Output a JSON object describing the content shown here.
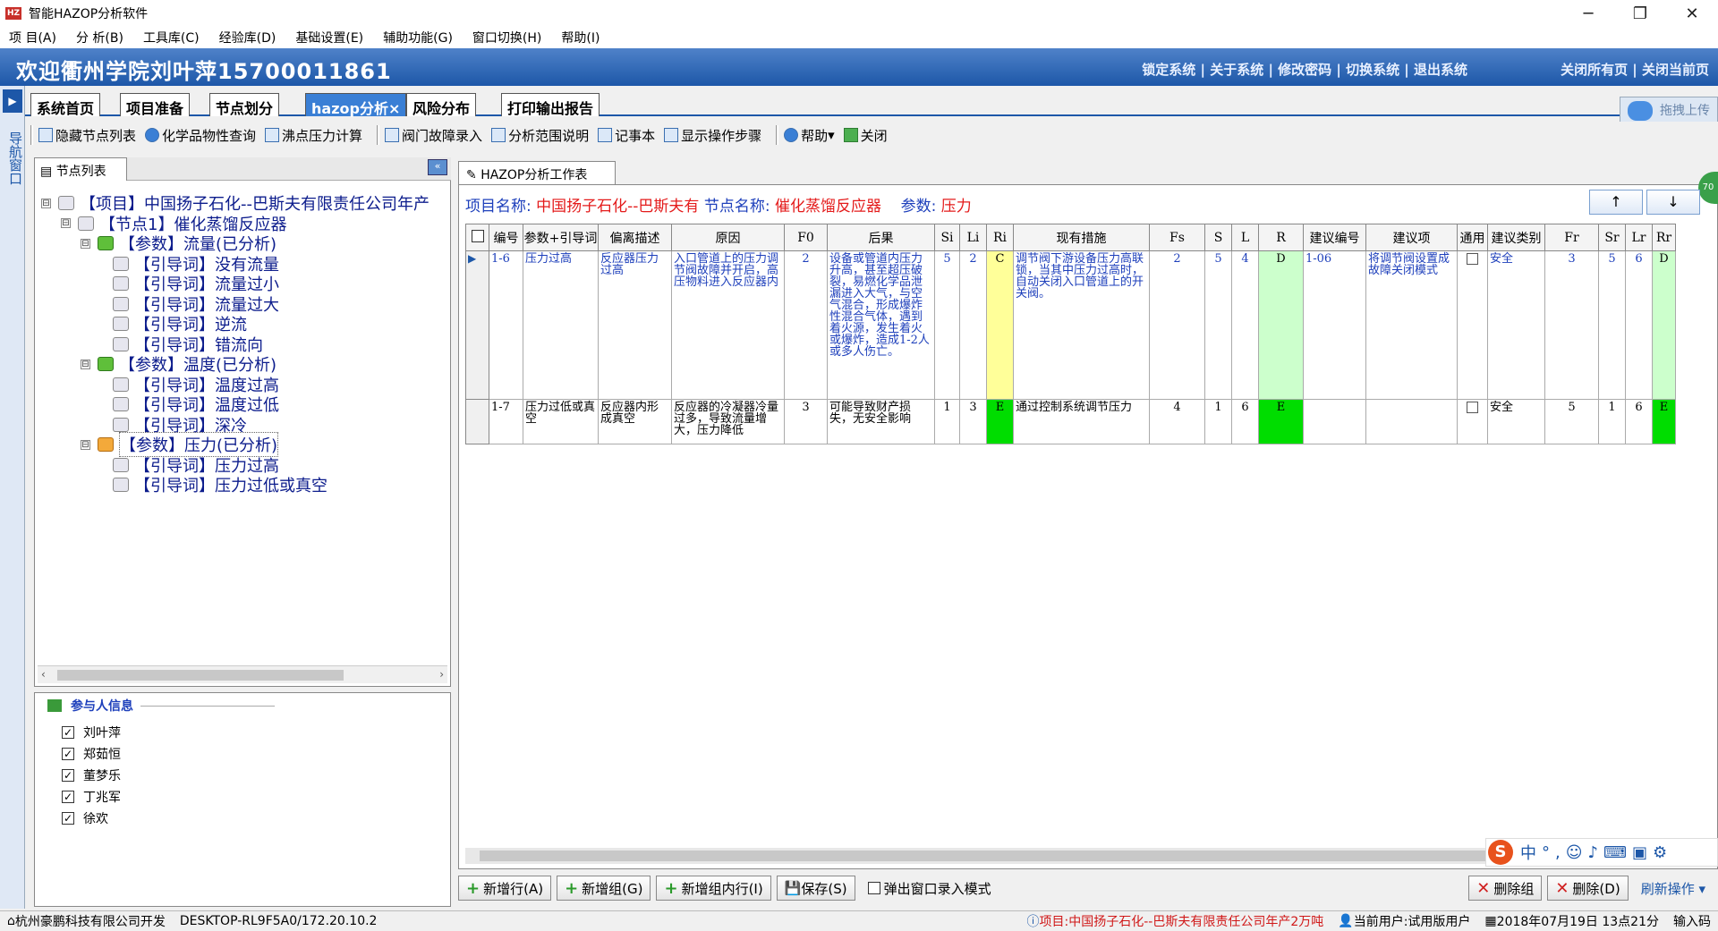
{
  "window": {
    "title": "智能HAZOP分析软件",
    "app_icon_text": "HZ"
  },
  "menu": [
    "项 目(A)",
    "分 析(B)",
    "工具库(C)",
    "经验库(D)",
    "基础设置(E)",
    "辅助功能(G)",
    "窗口切换(H)",
    "帮助(I)"
  ],
  "banner": {
    "welcome": "欢迎衢州学院刘叶萍15700011861",
    "links": "锁定系统 | 关于系统 | 修改密码 | 切换系统 | 退出系统",
    "links2": "关闭所有页 | 关闭当前页"
  },
  "navstrip": {
    "label": "导航窗口"
  },
  "tabs": [
    "系统首页",
    "项目准备",
    "节点划分",
    "hazop分析",
    "风险分布",
    "打印输出报告"
  ],
  "active_tab_close": "×",
  "drag_upload": "拖拽上传",
  "toolbar": [
    "隐藏节点列表",
    "化学品物性查询",
    "沸点压力计算",
    "阀门故障录入",
    "分析范围说明",
    "记事本",
    "显示操作步骤",
    "帮助",
    "关闭"
  ],
  "left_panel": {
    "tab": "节点列表",
    "collapse": "«"
  },
  "tree": [
    {
      "level": 0,
      "exp": "⊟",
      "text": "【项目】中国扬子石化--巴斯夫有限责任公司年产",
      "icon": "project"
    },
    {
      "level": 1,
      "exp": "⊟",
      "text": "【节点1】催化蒸馏反应器",
      "icon": "node"
    },
    {
      "level": 2,
      "exp": "⊟",
      "text": "【参数】流量(已分析)",
      "icon": "param-green"
    },
    {
      "level": 3,
      "exp": "",
      "text": "【引导词】没有流量",
      "icon": "guide"
    },
    {
      "level": 3,
      "exp": "",
      "text": "【引导词】流量过小",
      "icon": "guide"
    },
    {
      "level": 3,
      "exp": "",
      "text": "【引导词】流量过大",
      "icon": "guide"
    },
    {
      "level": 3,
      "exp": "",
      "text": "【引导词】逆流",
      "icon": "guide"
    },
    {
      "level": 3,
      "exp": "",
      "text": "【引导词】错流向",
      "icon": "guide"
    },
    {
      "level": 2,
      "exp": "⊟",
      "text": "【参数】温度(已分析)",
      "icon": "param-green"
    },
    {
      "level": 3,
      "exp": "",
      "text": "【引导词】温度过高",
      "icon": "guide"
    },
    {
      "level": 3,
      "exp": "",
      "text": "【引导词】温度过低",
      "icon": "guide"
    },
    {
      "level": 3,
      "exp": "",
      "text": "【引导词】深冷",
      "icon": "guide"
    },
    {
      "level": 2,
      "exp": "⊟",
      "text": "【参数】压力(已分析)",
      "icon": "param-orange"
    },
    {
      "level": 3,
      "exp": "",
      "text": "【引导词】压力过高",
      "icon": "guide"
    },
    {
      "level": 3,
      "exp": "",
      "text": "【引导词】压力过低或真空",
      "icon": "guide"
    }
  ],
  "participants": {
    "title": "参与人信息",
    "people": [
      "刘叶萍",
      "郑茹恒",
      "董梦乐",
      "丁兆军",
      "徐欢"
    ]
  },
  "work_tab": "HAZOP分析工作表",
  "info": {
    "project_label": "项目名称:",
    "project_value": "中国扬子石化--巴斯夫有",
    "node_label": "节点名称:",
    "node_value": "催化蒸馏反应器",
    "param_label": "参数:",
    "param_value": "压力"
  },
  "nav_arrows": {
    "up": "↑",
    "down": "↓"
  },
  "grid": {
    "headers": [
      "编号",
      "参数+引导词",
      "偏离描述",
      "原因",
      "F0",
      "后果",
      "Si",
      "Li",
      "Ri",
      "现有措施",
      "Fs",
      "S",
      "L",
      "R",
      "建议编号",
      "建议项",
      "通用",
      "建议类别",
      "Fr",
      "Sr",
      "Lr",
      "Rr"
    ],
    "rows": [
      {
        "id": "1-6",
        "param": "压力过高",
        "desc": "反应器压力过高",
        "cause": "入口管道上的压力调节阀故障并开启，高压物料进入反应器内",
        "f0": "2",
        "consequence": "设备或管道内压力升高，甚至超压破裂，易燃化学品泄漏进入大气，与空气混合，形成爆炸性混合气体，遇到着火源，发生着火或爆炸，造成1-2人或多人伤亡。",
        "si": "5",
        "li": "2",
        "ri": "C",
        "measure": "调节阀下游设备压力高联锁，当其中压力过高时，自动关闭入口管道上的开关阀。",
        "fs": "2",
        "s": "5",
        "l": "4",
        "r": "D",
        "sug_id": "1-06",
        "suggestion": "将调节阀设置成故障关闭模式",
        "general": "",
        "category": "安全",
        "fr": "3",
        "sr": "5",
        "lr": "6",
        "rr": "D"
      },
      {
        "id": "1-7",
        "param": "压力过低或真空",
        "desc": "反应器内形成真空",
        "cause": "反应器的冷凝器冷量过多，导致流量增大，压力降低",
        "f0": "3",
        "consequence": "可能导致财产损失，无安全影响",
        "si": "1",
        "li": "3",
        "ri": "E",
        "measure": "通过控制系统调节压力",
        "fs": "4",
        "s": "1",
        "l": "6",
        "r": "E",
        "sug_id": "",
        "suggestion": "",
        "general": "",
        "category": "安全",
        "fr": "5",
        "sr": "1",
        "lr": "6",
        "rr": "E"
      }
    ]
  },
  "risk_colors": {
    "C": "#ffff99",
    "D": "#ccffcc",
    "E": "#00dd00"
  },
  "bottom_buttons": {
    "add_row": "新增行(A)",
    "add_group": "新增组(G)",
    "add_in_group": "新增组内行(I)",
    "save": "保存(S)",
    "popup_mode": "弹出窗口录入模式",
    "delete_group": "删除组",
    "delete": "删除(D)",
    "refresh": "刷新操作 ▾"
  },
  "statusbar": {
    "company": "杭州豪鹏科技有限公司开发",
    "host": "DESKTOP-RL9F5A0/172.20.10.2",
    "project": "项目:中国扬子石化--巴斯夫有限责任公司年产2万吨",
    "user": "当前用户:试用版用户",
    "datetime": "2018年07月19日 13点21分",
    "ime_hint": "输入码"
  },
  "ime": {
    "logo": "S",
    "lang": "中",
    "extra": "°,☺♪⌨▣⚙"
  },
  "badge": "70"
}
